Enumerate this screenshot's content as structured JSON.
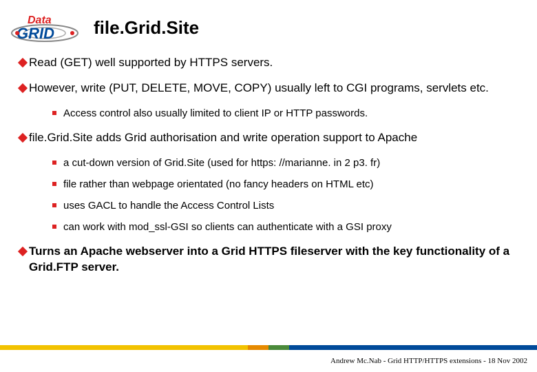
{
  "logo": {
    "top_text": "Data",
    "bottom_text": "GRID",
    "alt": "DataGRID logo"
  },
  "title": "file.Grid.Site",
  "bullets": [
    {
      "text": "Read (GET) well supported by HTTPS servers.",
      "bold": false,
      "sub": []
    },
    {
      "text": "However, write (PUT, DELETE, MOVE, COPY) usually left to CGI programs, servlets etc.",
      "bold": false,
      "sub": [
        "Access control also usually limited to client IP or HTTP passwords."
      ]
    },
    {
      "text": "file.Grid.Site adds Grid authorisation and write operation support to Apache",
      "bold": false,
      "sub": [
        "a cut-down version of Grid.Site (used for https: //marianne. in 2 p3. fr)",
        "file rather than webpage orientated (no fancy headers on HTML etc)",
        "uses GACL to handle the Access Control Lists",
        "can work with mod_ssl-GSI so clients can authenticate with a GSI proxy"
      ]
    },
    {
      "text": "Turns an Apache webserver into a Grid HTTPS fileserver with the key functionality of a Grid.FTP server.",
      "bold": true,
      "sub": []
    }
  ],
  "footer": "Andrew Mc.Nab - Grid HTTP/HTTPS extensions - 18 Nov 2002",
  "colors": {
    "bullet_red": "#d22",
    "bar_yellow": "#f2c200",
    "bar_orange": "#e68a00",
    "bar_green": "#4a8a3a",
    "bar_blue": "#004a9a"
  }
}
